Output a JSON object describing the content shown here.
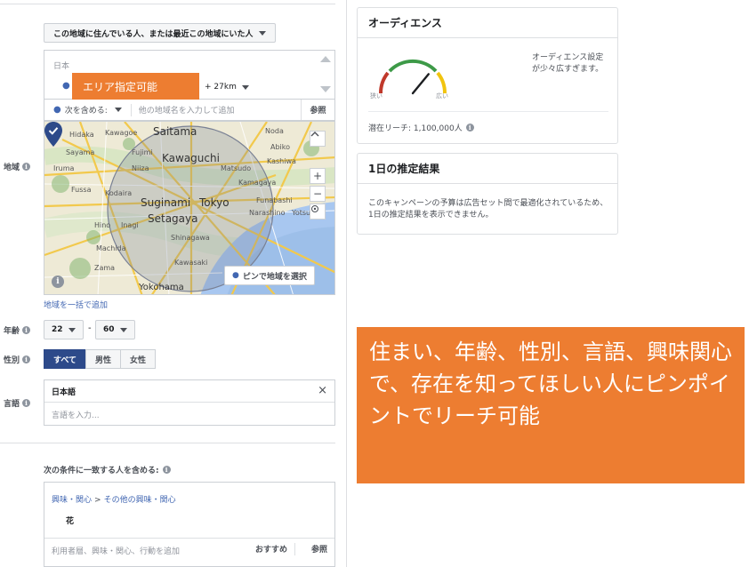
{
  "targeting": {
    "location_type": "この地域に住んでいる人、または最近この地域にいた人",
    "location": {
      "country": "日本",
      "radius": "+ 27km",
      "include_label": "次を含める:",
      "input_placeholder": "他の地域名を入力して追加",
      "browse": "参照",
      "bulk_link": "地域を一括で追加"
    },
    "labels": {
      "location": "地域",
      "age": "年齢",
      "gender": "性別",
      "language": "言語"
    },
    "age": {
      "min": "22",
      "max": "60",
      "separator": "-"
    },
    "gender": {
      "options": [
        "すべて",
        "男性",
        "女性"
      ],
      "selected": "すべて"
    },
    "language": {
      "selected": "日本語",
      "placeholder": "言語を入力...",
      "clear": "×"
    },
    "detailed": {
      "label": "次の条件に一致する人を含める:",
      "breadcrumb": [
        "興味・関心",
        "その他の興味・関心"
      ],
      "breadcrumb_sep": ">",
      "item": "花",
      "input_placeholder": "利用者層、興味・関心、行動を追加",
      "recommend": "おすすめ",
      "browse": "参照"
    }
  },
  "map": {
    "labels": {
      "hidaka": "Hidaka",
      "kawagoe": "Kawagoe",
      "saitama": "Saitama",
      "noda": "Noda",
      "sayama": "Sayama",
      "fujimi": "Fujimi",
      "abiko": "Abiko",
      "kawaguchi": "Kawaguchi",
      "iruma": "Iruma",
      "niiza": "Niiza",
      "matsudo": "Matsudo",
      "kashiwa": "Kashiwa",
      "fussa": "Fussa",
      "kodaira": "Kodaira",
      "kamagaya": "Kamagaya",
      "suginami": "Suginami",
      "tokyo": "Tokyo",
      "funabashi": "Funabashi",
      "setagaya": "Setagaya",
      "narashino": "Narashino",
      "yotsukaido": "Yotsu",
      "hino": "Hino",
      "inagi": "Inagi",
      "shinagawa": "Shinagawa",
      "machida": "Machida",
      "kawasaki": "Kawasaki",
      "zama": "Zama",
      "yokohama": "Yokohama"
    },
    "controls": {
      "zoom_in": "+",
      "zoom_out": "−"
    },
    "pin_button": "ピンで地域を選択",
    "info": "i"
  },
  "overlay_tag": "エリア指定可能",
  "audience": {
    "title": "オーディエンス",
    "narrow": "狭い",
    "wide": "広い",
    "note": "オーディエンス設定が少々広すぎます。",
    "reach": "潜在リーチ: 1,100,000人",
    "gauge_level": 0.72
  },
  "daily": {
    "title": "1日の推定結果",
    "text": "このキャンペーンの予算は広告セット間で最適化されているため、1日の推定結果を表示できません。"
  },
  "callout": "住まい、年齢、性別、言語、興味関心で、存在を知ってほしい人にピンポイントでリーチ可能",
  "colors": {
    "accent": "#ed7d31",
    "link": "#4267b2",
    "active": "#2d4a8a"
  }
}
